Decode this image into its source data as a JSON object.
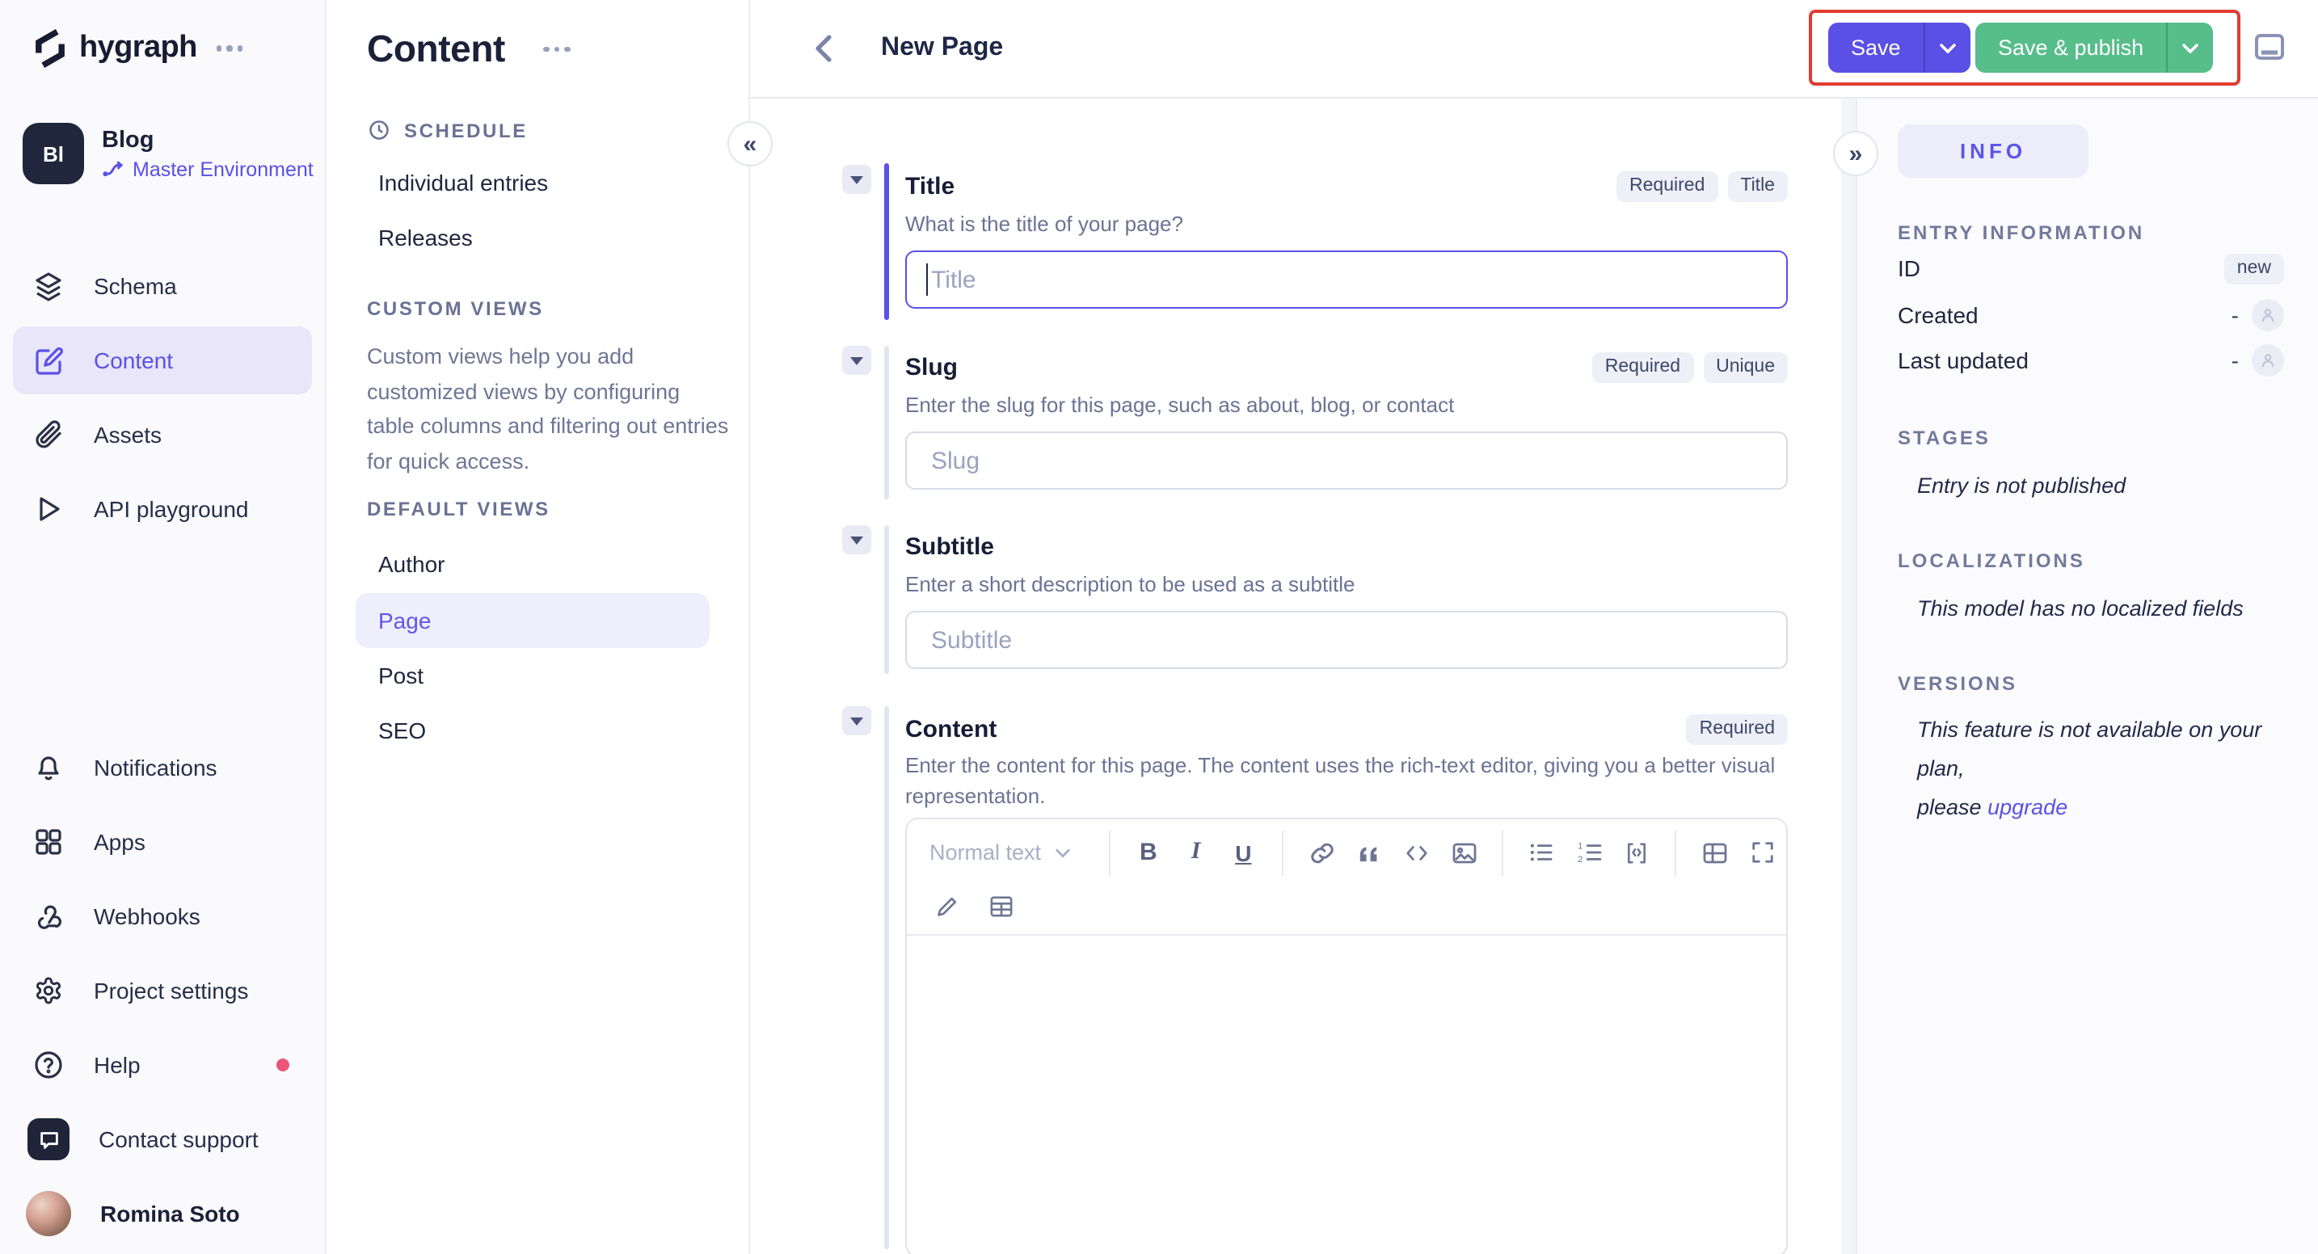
{
  "colors": {
    "accent": "#5B50E6",
    "publish_green": "#57BD8B",
    "annotation_red": "#E23B30",
    "help_dot_pink": "#EC5577",
    "active_nav_bg": "#E8E6F8"
  },
  "app_sidebar": {
    "logo_text": "hygraph",
    "project": {
      "initials": "Bl",
      "name": "Blog",
      "environment": "Master Environment"
    },
    "nav": [
      {
        "label": "Schema",
        "icon": "layers-icon"
      },
      {
        "label": "Content",
        "icon": "edit-icon",
        "active": true
      },
      {
        "label": "Assets",
        "icon": "paperclip-icon"
      },
      {
        "label": "API playground",
        "icon": "play-icon"
      }
    ],
    "nav_bottom": [
      {
        "label": "Notifications",
        "icon": "bell-icon"
      },
      {
        "label": "Apps",
        "icon": "grid-icon"
      },
      {
        "label": "Webhooks",
        "icon": "webhook-icon"
      },
      {
        "label": "Project settings",
        "icon": "gear-icon"
      },
      {
        "label": "Help",
        "icon": "question-icon",
        "has_dot": true
      },
      {
        "label": "Contact support",
        "icon": "chat-icon"
      }
    ],
    "user": {
      "name": "Romina Soto"
    }
  },
  "content_sidebar": {
    "title": "Content",
    "schedule": {
      "header": "SCHEDULE",
      "items": [
        "Individual entries",
        "Releases"
      ]
    },
    "custom_views": {
      "header": "CUSTOM VIEWS",
      "description": "Custom views help you add customized views by configuring table columns and filtering out entries for quick access."
    },
    "default_views": {
      "header": "DEFAULT VIEWS",
      "items": [
        "Author",
        "Page",
        "Post",
        "SEO"
      ],
      "selected": "Page"
    }
  },
  "topbar": {
    "title": "New Page",
    "save_label": "Save",
    "save_publish_label": "Save & publish"
  },
  "form": {
    "title": {
      "label": "Title",
      "badges": [
        "Required",
        "Title"
      ],
      "helper": "What is the title of your page?",
      "placeholder": "Title"
    },
    "slug": {
      "label": "Slug",
      "badges": [
        "Required",
        "Unique"
      ],
      "helper": "Enter the slug for this page, such as about, blog, or contact",
      "placeholder": "Slug"
    },
    "subtitle": {
      "label": "Subtitle",
      "helper": "Enter a short description to be used as a subtitle",
      "placeholder": "Subtitle"
    },
    "content": {
      "label": "Content",
      "badges": [
        "Required"
      ],
      "helper": "Enter the content for this page. The content uses the rich-text editor, giving you a better visual representation.",
      "toolbar": {
        "paragraph_style": "Normal text"
      }
    }
  },
  "right_panel": {
    "tab": "INFO",
    "entry_information": {
      "header": "ENTRY INFORMATION",
      "rows": [
        {
          "label": "ID",
          "value": "new"
        },
        {
          "label": "Created",
          "value": "-"
        },
        {
          "label": "Last updated",
          "value": "-"
        }
      ]
    },
    "stages": {
      "header": "STAGES",
      "text": "Entry is not published"
    },
    "localizations": {
      "header": "LOCALIZATIONS",
      "text": "This model has no localized fields"
    },
    "versions": {
      "header": "VERSIONS",
      "line1": "This feature is not available on your plan,",
      "line2": "please",
      "link": "upgrade"
    }
  }
}
